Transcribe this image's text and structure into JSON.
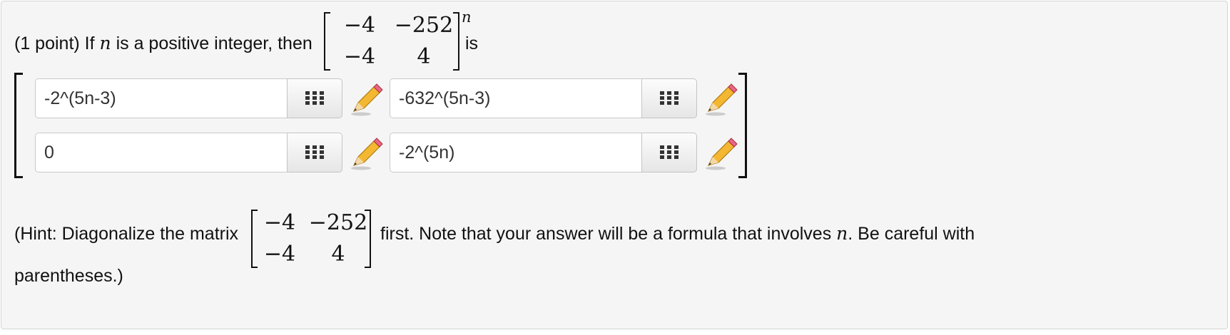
{
  "question": {
    "prefix": "(1 point) If",
    "var_n": "n",
    "middle": "is a positive integer, then",
    "matrix": {
      "a11": "−4",
      "a12": "−252",
      "a21": "−4",
      "a22": "4"
    },
    "exponent": "n",
    "suffix": "is"
  },
  "answers": [
    {
      "value": "-2^(5n-3)"
    },
    {
      "value": "-632^(5n-3)"
    },
    {
      "value": "0"
    },
    {
      "value": "-2^(5n)"
    }
  ],
  "icons": {
    "keypad": "keypad-icon",
    "pencil": "pencil-icon"
  },
  "hint": {
    "prefix": "(Hint: Diagonalize the matrix",
    "matrix": {
      "a11": "−4",
      "a12": "−252",
      "a21": "−4",
      "a22": "4"
    },
    "middle": "first. Note that your answer will be a formula that involves",
    "var_n": "n",
    "after_n": ". Be careful with",
    "line2": "parentheses.)"
  }
}
